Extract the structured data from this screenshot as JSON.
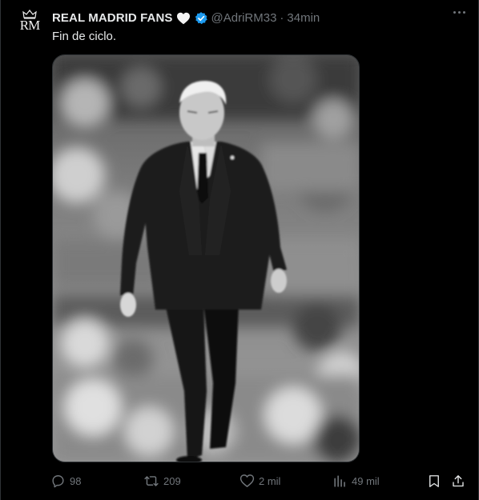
{
  "author": {
    "name": "REAL MADRID FANS",
    "handle": "@AdriRM33",
    "separator": "·",
    "time": "34min",
    "avatar_monogram": "RM",
    "name_emoji": "white-heart-icon",
    "verified_icon": "verified-badge-icon"
  },
  "tweet": {
    "text": "Fin de ciclo."
  },
  "actions": {
    "replies": "98",
    "reposts": "209",
    "likes": "2 mil",
    "views": "49 mil"
  },
  "colors": {
    "background": "#000000",
    "text": "#e7e9ea",
    "muted": "#71767b",
    "verified": "#1d9bf0",
    "border": "#2f3336"
  }
}
